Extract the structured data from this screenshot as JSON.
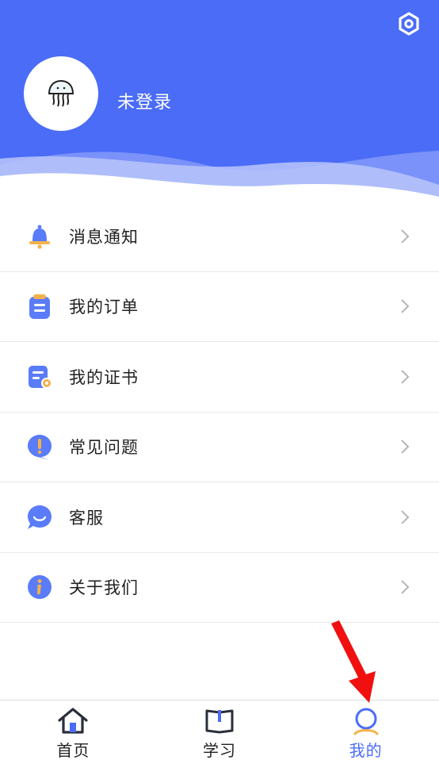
{
  "header": {
    "bg_color": "#4a6cf7",
    "settings_icon": "gear-icon",
    "avatar_icon": "jellyfish-icon",
    "login_text": "未登录"
  },
  "menu": {
    "items": [
      {
        "label": "消息通知",
        "icon": "bell-icon"
      },
      {
        "label": "我的订单",
        "icon": "order-icon"
      },
      {
        "label": "我的证书",
        "icon": "certificate-icon"
      },
      {
        "label": "常见问题",
        "icon": "faq-icon"
      },
      {
        "label": "客服",
        "icon": "customer-service-icon"
      },
      {
        "label": "关于我们",
        "icon": "info-icon"
      }
    ]
  },
  "tabbar": {
    "tabs": [
      {
        "label": "首页",
        "icon": "home-icon",
        "active": false
      },
      {
        "label": "学习",
        "icon": "book-icon",
        "active": false
      },
      {
        "label": "我的",
        "icon": "user-icon",
        "active": true
      }
    ],
    "active_color": "#4a6cf7"
  },
  "annotation": {
    "icon": "red-arrow-icon",
    "color": "#f01010"
  }
}
